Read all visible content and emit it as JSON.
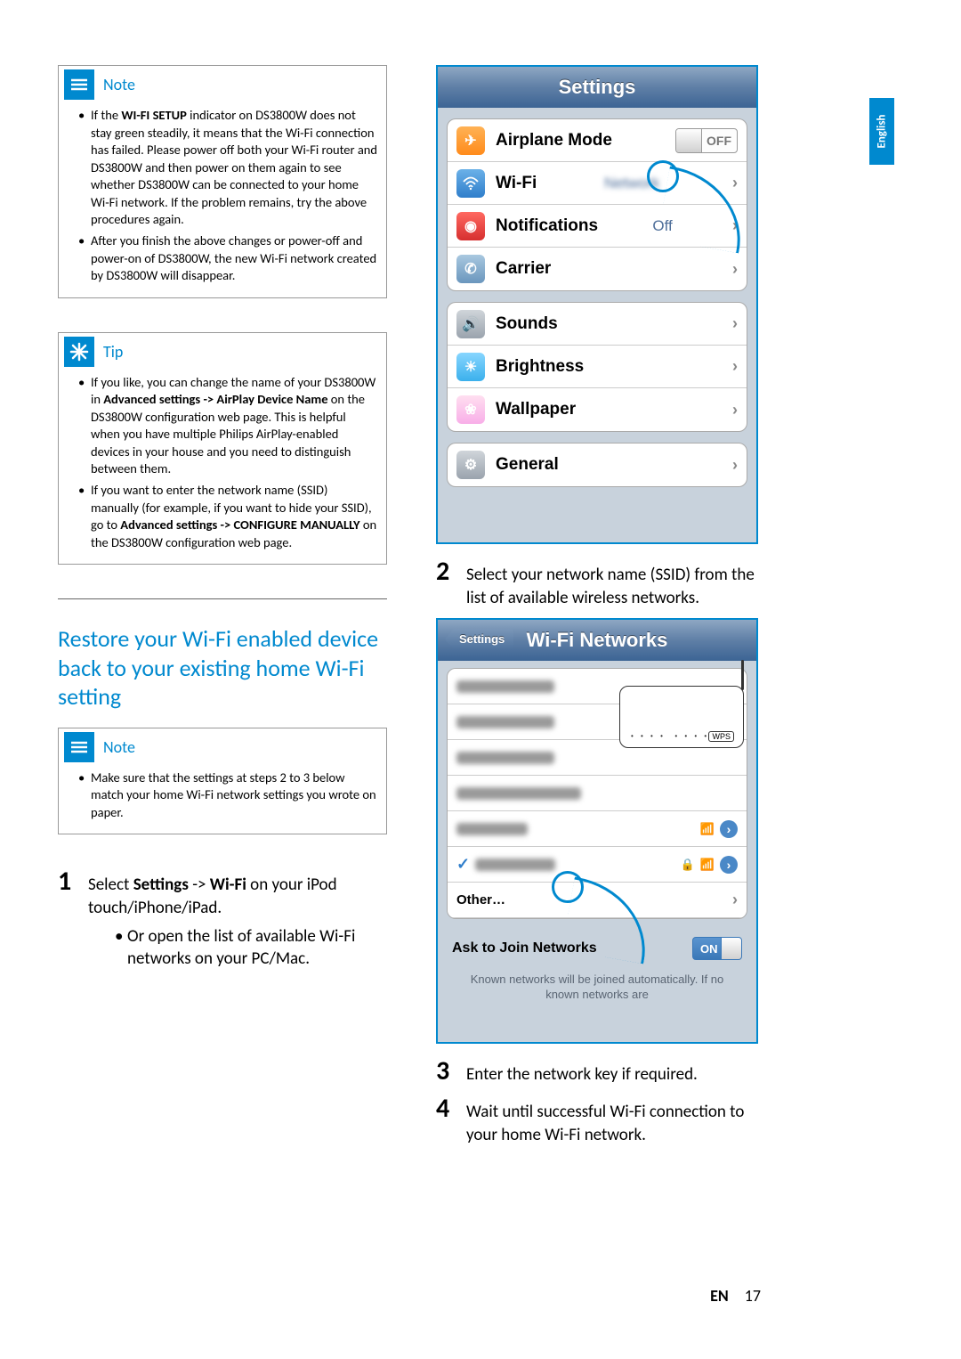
{
  "language_tab": "English",
  "footer": {
    "lang": "EN",
    "page": "17"
  },
  "callout_note1": {
    "title": "Note",
    "bullets": [
      {
        "pre": "If the ",
        "b1": "WI-FI SETUP",
        "post": " indicator on DS3800W does not stay green steadily, it means that the Wi-Fi connection has failed. Please power off both your Wi-Fi router and DS3800W and then power on them again to see whether DS3800W can be connected to your home Wi-Fi network. If the problem remains, try the above procedures again."
      },
      {
        "text": "After you finish the above changes or power-off and power-on of DS3800W, the new Wi-Fi network created by DS3800W will disappear."
      }
    ]
  },
  "callout_tip": {
    "title": "Tip",
    "bullets": [
      {
        "pre": "If you like, you can change the name of your DS3800W in ",
        "b1": "Advanced settings -> AirPlay Device Name",
        "post": " on the DS3800W configuration web page. This is helpful when you have multiple Philips AirPlay-enabled devices in your house and you need to distinguish between them."
      },
      {
        "pre": "If you want to enter the network name (SSID) manually (for example, if you want to hide your SSID), go to ",
        "b1": "Advanced settings -> CONFIGURE MANUALLY",
        "post": " on the DS3800W configuration web page."
      }
    ]
  },
  "section_heading": "Restore your Wi-Fi enabled device back to your existing home Wi-Fi setting",
  "callout_note2": {
    "title": "Note",
    "bullets": [
      {
        "text": "Make sure that the settings at steps 2 to 3 below match your home Wi-Fi network settings you wrote on paper."
      }
    ]
  },
  "step1": {
    "num": "1",
    "pre": "Select ",
    "b1": "Settings",
    "mid": " -> ",
    "b2": "Wi-Fi",
    "post": " on your iPod touch/iPhone/iPad.",
    "sub": "Or open the list of available Wi-Fi networks on your PC/Mac."
  },
  "step2": {
    "num": "2",
    "text": "Select your network name (SSID) from the list of available wireless networks."
  },
  "step3": {
    "num": "3",
    "text": "Enter the network key if required."
  },
  "step4": {
    "num": "4",
    "text": "Wait until successful Wi-Fi connection to your home Wi-Fi network."
  },
  "ios_settings": {
    "title": "Settings",
    "rows": {
      "airplane": "Airplane Mode",
      "airplane_off": "OFF",
      "wifi": "Wi-Fi",
      "notifications": "Notifications",
      "notifications_value": "Off",
      "carrier": "Carrier",
      "sounds": "Sounds",
      "brightness": "Brightness",
      "wallpaper": "Wallpaper",
      "general": "General"
    }
  },
  "ios_wifi": {
    "back": "Settings",
    "title": "Wi-Fi Networks",
    "other": "Other…",
    "ask": "Ask to Join Networks",
    "on": "ON",
    "footer": "Known networks will be joined automatically. If no known networks are"
  }
}
